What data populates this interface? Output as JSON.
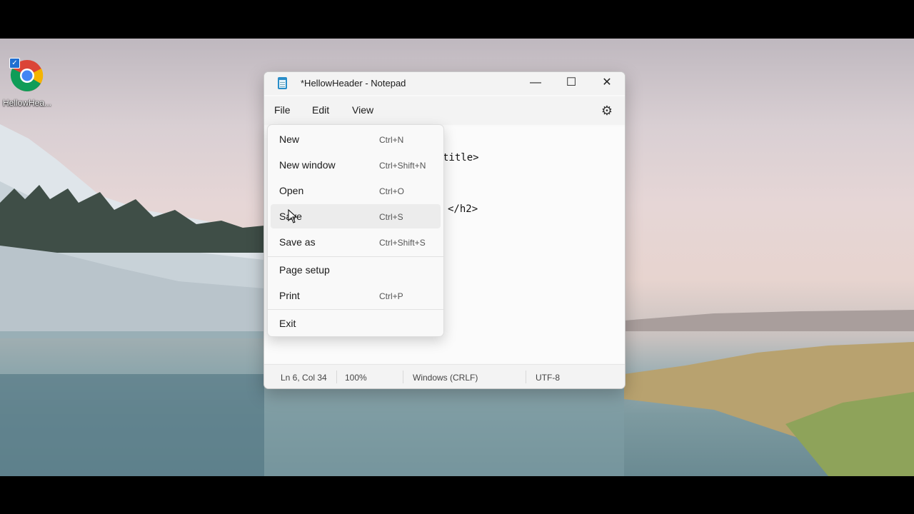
{
  "desktop": {
    "icon": {
      "label": "HellowHea...",
      "icon": "chrome-icon"
    }
  },
  "window": {
    "title": "*HellowHeader - Notepad",
    "controls": {
      "minimize": "—",
      "maximize": "☐",
      "close": "✕"
    },
    "menu": [
      "File",
      "Edit",
      "View"
    ],
    "settings_icon": "gear-icon",
    "editor_lines": [
      {
        "text": "title>"
      },
      {
        "text": "</h2>"
      }
    ],
    "status": {
      "position": "Ln 6, Col 34",
      "zoom": "100%",
      "line_ending": "Windows (CRLF)",
      "encoding": "UTF-8"
    }
  },
  "file_menu": {
    "items": [
      {
        "label": "New",
        "shortcut": "Ctrl+N"
      },
      {
        "label": "New window",
        "shortcut": "Ctrl+Shift+N"
      },
      {
        "label": "Open",
        "shortcut": "Ctrl+O"
      },
      {
        "label": "Save",
        "shortcut": "Ctrl+S"
      },
      {
        "label": "Save as",
        "shortcut": "Ctrl+Shift+S"
      },
      {
        "label": "Page setup",
        "shortcut": ""
      },
      {
        "label": "Print",
        "shortcut": "Ctrl+P"
      },
      {
        "label": "Exit",
        "shortcut": ""
      }
    ],
    "hovered": "Save"
  }
}
